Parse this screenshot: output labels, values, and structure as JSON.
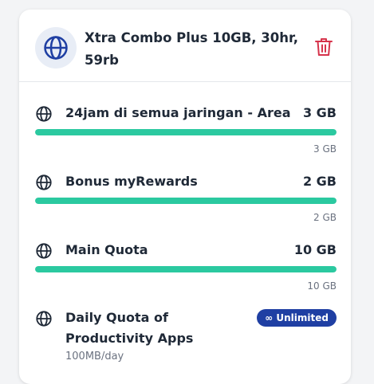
{
  "package": {
    "title": "Xtra Combo Plus 10GB, 30hr, 59rb",
    "icon": "globe-icon",
    "delete_icon": "trash-icon"
  },
  "quotas": [
    {
      "name": "24jam di semua jaringan - Area",
      "amount": "3 GB",
      "remaining": "3 GB",
      "level": 1.0,
      "icon": "globe-icon"
    },
    {
      "name": "Bonus myRewards",
      "amount": "2 GB",
      "remaining": "2 GB",
      "level": 1.0,
      "icon": "globe-icon"
    },
    {
      "name": "Main Quota",
      "amount": "10 GB",
      "remaining": "10 GB",
      "level": 1.0,
      "icon": "globe-icon"
    }
  ],
  "daily": {
    "name": "Daily Quota of Productivity Apps",
    "detail": "100MB/day",
    "badge_label": "∞ Unlimited",
    "icon": "globe-icon"
  },
  "colors": {
    "progress": "#2bc9a0",
    "badge": "#1f3fa3",
    "delete": "#d6334b",
    "accent": "#1f3fa3"
  }
}
